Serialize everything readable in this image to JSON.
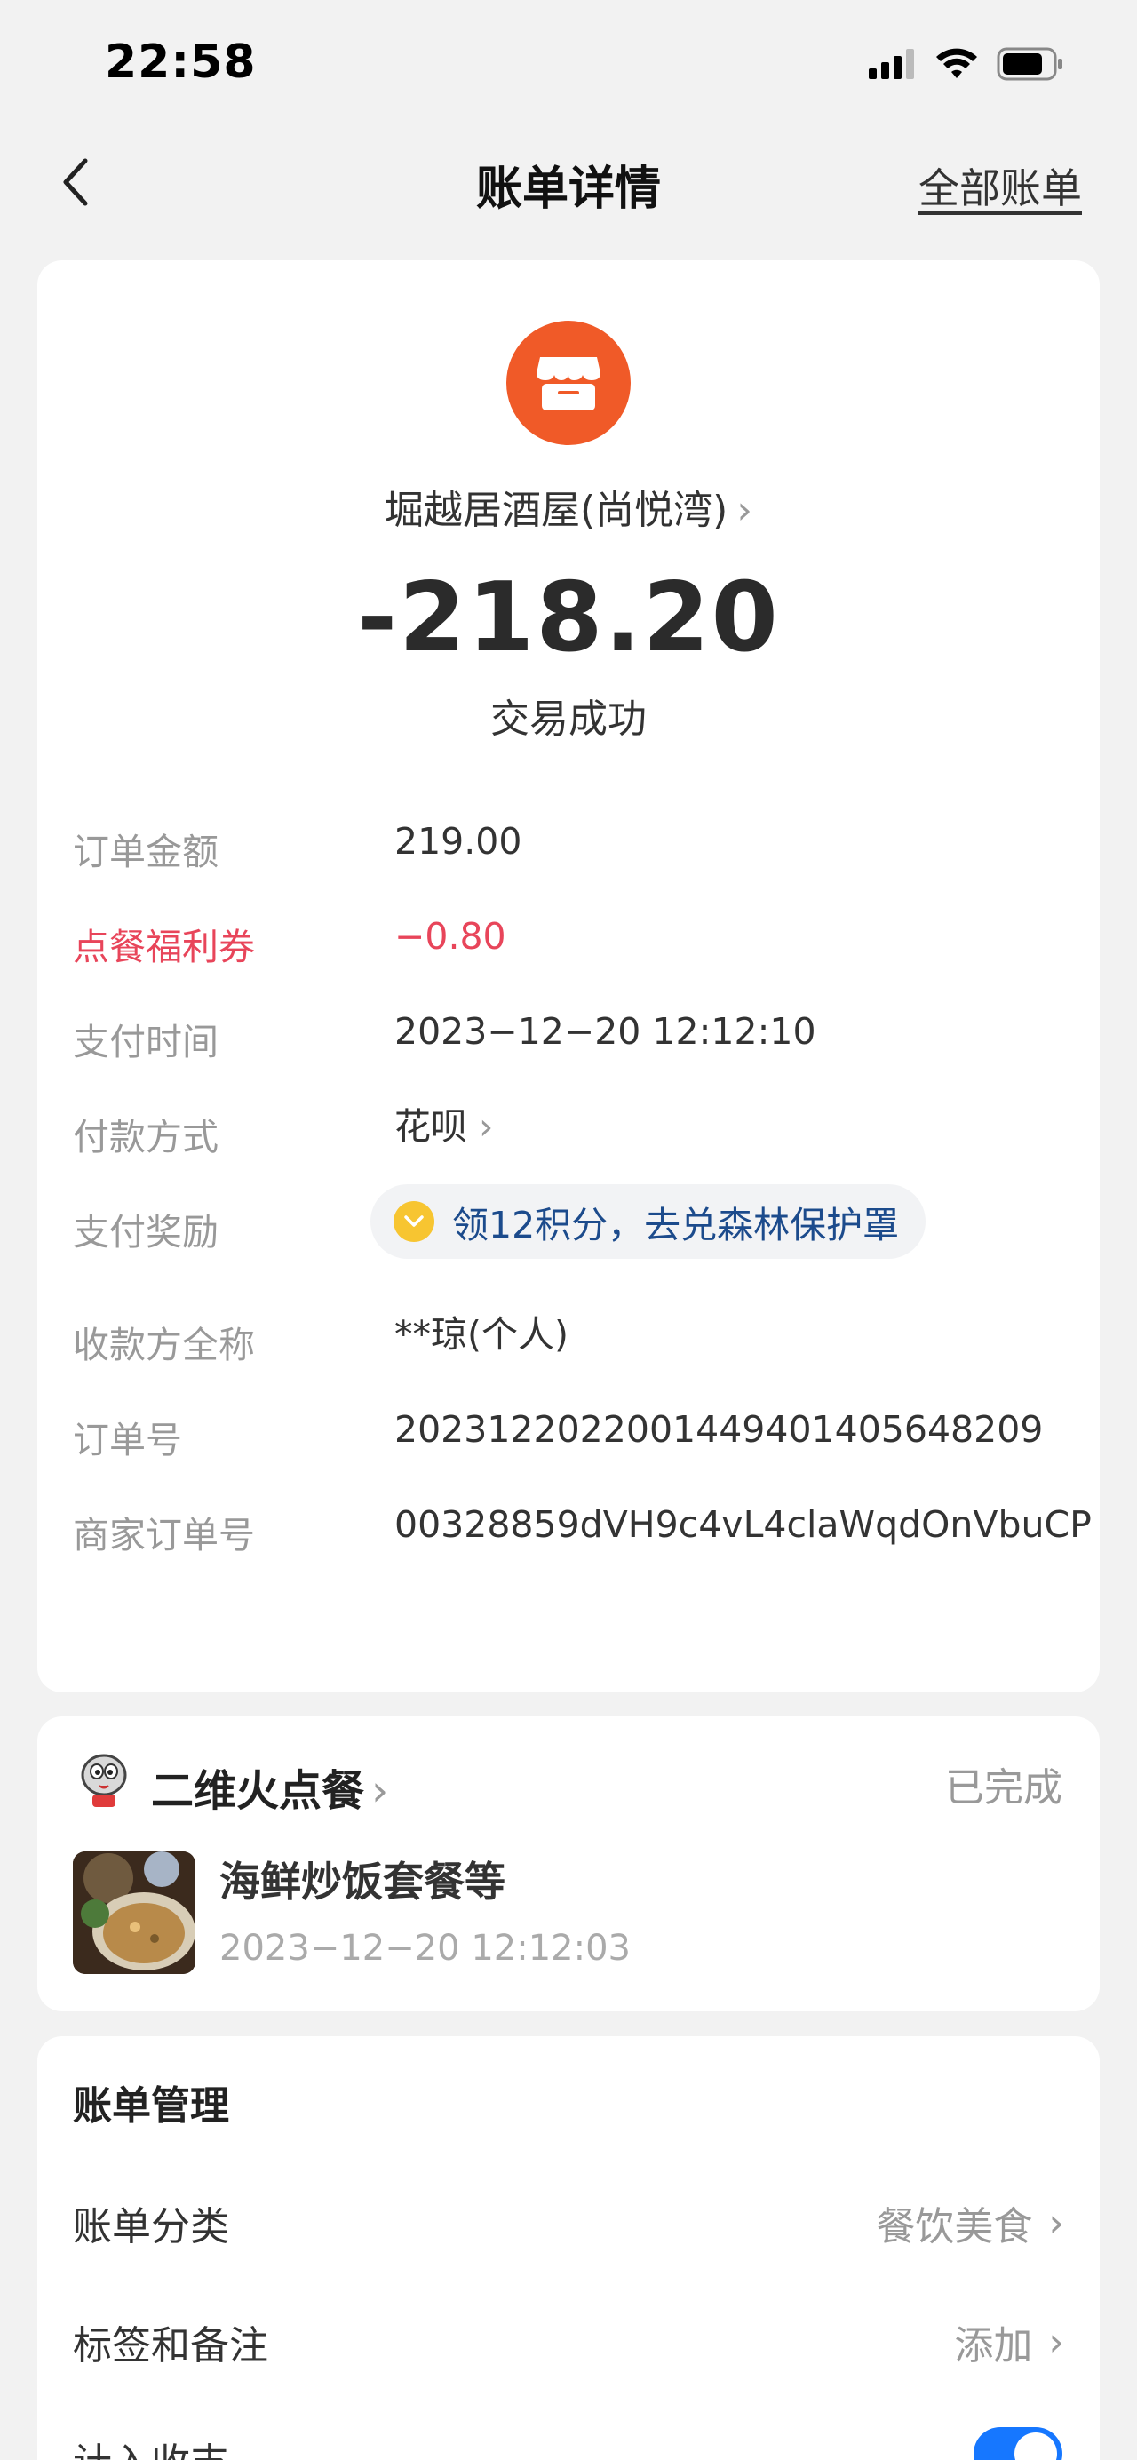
{
  "status_bar": {
    "time": "22:58"
  },
  "nav": {
    "title": "账单详情",
    "all_bills": "全部账单"
  },
  "transaction": {
    "merchant": "堀越居酒屋(尚悦湾)",
    "amount": "-218.20",
    "status": "交易成功"
  },
  "details": {
    "order_amount_label": "订单金额",
    "order_amount": "219.00",
    "coupon_label": "点餐福利券",
    "coupon_value": "−0.80",
    "pay_time_label": "支付时间",
    "pay_time": "2023−12−20 12:12:10",
    "pay_method_label": "付款方式",
    "pay_method": "花呗",
    "reward_label": "支付奖励",
    "reward_text": "领12积分，去兑森林保护罩",
    "payee_label": "收款方全称",
    "payee": "**琼(个人)",
    "order_no_label": "订单号",
    "order_no": "2023122022001449401405648209",
    "merchant_order_label": "商家订单号",
    "merchant_order_no": "00328859dVH9c4vL4claWqdOnVbuCP"
  },
  "service": {
    "name": "二维火点餐",
    "status": "已完成",
    "order_title": "海鲜炒饭套餐等",
    "order_time": "2023−12−20 12:12:03"
  },
  "management": {
    "title": "账单管理",
    "category_label": "账单分类",
    "category_value": "餐饮美食",
    "tags_label": "标签和备注",
    "tags_value": "添加",
    "count_label": "计入收支",
    "count_enabled": true
  },
  "colors": {
    "accent_orange": "#f05a28",
    "discount_red": "#e8455a",
    "link_blue": "#1c4b8c",
    "toggle_blue": "#1677ff"
  }
}
